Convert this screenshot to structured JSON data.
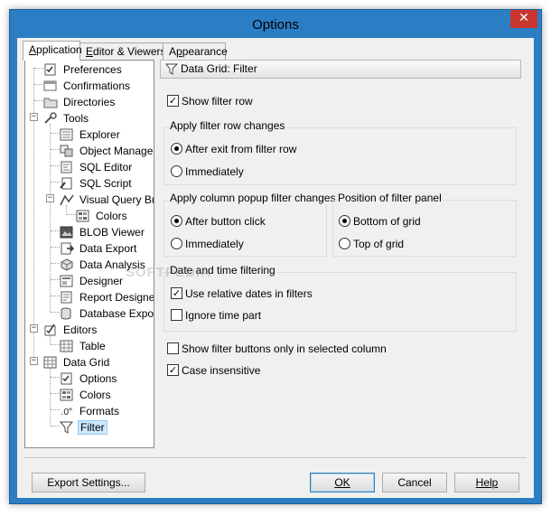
{
  "window": {
    "title": "Options",
    "close_glyph": "✕"
  },
  "tabs": [
    {
      "label": "Application",
      "mnemonic": "A",
      "rest": "pplication",
      "active": true
    },
    {
      "label": "Editor & Viewers",
      "mnemonic": "E",
      "rest": "ditor & Viewers",
      "active": false
    },
    {
      "label": "Appearance",
      "mnemonic": "p",
      "pre": "A",
      "rest": "pearance",
      "active": false
    }
  ],
  "tree": {
    "items": [
      {
        "label": "Preferences",
        "icon": "preferences-icon"
      },
      {
        "label": "Confirmations",
        "icon": "confirmations-icon"
      },
      {
        "label": "Directories",
        "icon": "directories-icon"
      },
      {
        "label": "Tools",
        "icon": "tools-icon",
        "expanded": true
      },
      {
        "label": "Explorer",
        "icon": "explorer-icon"
      },
      {
        "label": "Object Manager",
        "icon": "object-manager-icon"
      },
      {
        "label": "SQL Editor",
        "icon": "sql-editor-icon"
      },
      {
        "label": "SQL Script",
        "icon": "sql-script-icon"
      },
      {
        "label": "Visual Query Builder",
        "icon": "visual-query-builder-icon",
        "expanded": true
      },
      {
        "label": "Colors",
        "icon": "colors-icon"
      },
      {
        "label": "BLOB Viewer",
        "icon": "blob-viewer-icon"
      },
      {
        "label": "Data Export",
        "icon": "data-export-icon"
      },
      {
        "label": "Data Analysis",
        "icon": "data-analysis-icon"
      },
      {
        "label": "Designer",
        "icon": "designer-icon"
      },
      {
        "label": "Report Designer",
        "icon": "report-designer-icon"
      },
      {
        "label": "Database Export",
        "icon": "database-export-icon"
      },
      {
        "label": "Editors",
        "icon": "editors-icon",
        "expanded": true
      },
      {
        "label": "Table",
        "icon": "table-icon"
      },
      {
        "label": "Data Grid",
        "icon": "data-grid-icon",
        "expanded": true
      },
      {
        "label": "Options",
        "icon": "options-icon"
      },
      {
        "label": "Colors",
        "icon": "colors-icon"
      },
      {
        "label": "Formats",
        "icon": "formats-icon"
      },
      {
        "label": "Filter",
        "icon": "filter-icon",
        "selected": true
      }
    ]
  },
  "panel": {
    "header": "Data Grid: Filter",
    "show_filter_row": {
      "label": "Show filter row",
      "checked": true
    },
    "apply_changes": {
      "title": "Apply filter row changes",
      "options": [
        {
          "label": "After exit from filter row",
          "selected": true
        },
        {
          "label": "Immediately",
          "selected": false
        }
      ]
    },
    "apply_popup": {
      "title": "Apply column popup filter changes",
      "options": [
        {
          "label": "After button click",
          "selected": true
        },
        {
          "label": "Immediately",
          "selected": false
        }
      ]
    },
    "position": {
      "title": "Position of filter panel",
      "options": [
        {
          "label": "Bottom of grid",
          "selected": true
        },
        {
          "label": "Top of grid",
          "selected": false
        }
      ]
    },
    "datetime": {
      "title": "Date and time filtering",
      "use_relative": {
        "label": "Use relative dates in filters",
        "checked": true
      },
      "ignore_time": {
        "label": "Ignore time part",
        "checked": false
      }
    },
    "show_buttons_selected": {
      "label": "Show filter buttons only in selected column",
      "checked": false
    },
    "case_insensitive": {
      "label": "Case insensitive",
      "checked": true
    }
  },
  "buttons": {
    "export": "Export Settings...",
    "ok": "OK",
    "cancel": "Cancel",
    "help": "Help"
  },
  "watermark": "SOFTPEDIA",
  "colors": {
    "titlebar": "#2c7ec4",
    "close": "#c7372f",
    "selection": "#cde8ff"
  }
}
